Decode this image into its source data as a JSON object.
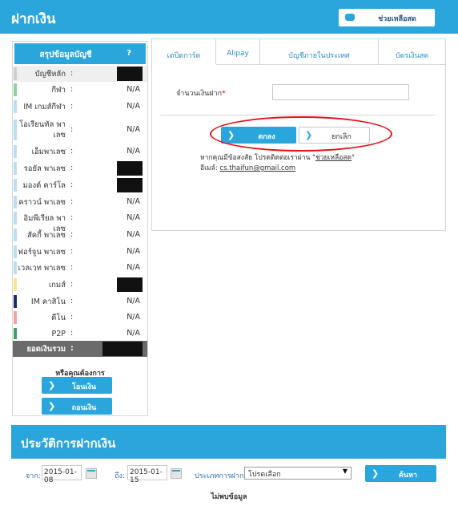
{
  "header": {
    "title": "ฝากเงิน",
    "help_label": "ช่วยเหลือสด"
  },
  "sidebar": {
    "title": "สรุปข้อมูลบัญชี",
    "help_mark": "?",
    "accounts": [
      {
        "name": "บัญชีหลัก",
        "value": "",
        "masked": true,
        "color": "#cfcfcf"
      },
      {
        "name": "กีฬา",
        "value": "N/A",
        "masked": false,
        "color": "#8fd0a0"
      },
      {
        "name": "IM เกมส์กีฬา",
        "value": "N/A",
        "masked": false,
        "color": "#b9dff0"
      },
      {
        "name": "โอเรียนทัล พาเลซ",
        "value": "N/A",
        "masked": false,
        "color": "#b9dff0"
      },
      {
        "name": "เอ็มพาเลซ",
        "value": "N/A",
        "masked": false,
        "color": "#b9dff0"
      },
      {
        "name": "รอยัล พาเลซ",
        "value": "",
        "masked": true,
        "color": "#b9dff0"
      },
      {
        "name": "มองต์ คาร์โล",
        "value": "",
        "masked": true,
        "color": "#b9dff0"
      },
      {
        "name": "คราวน์ พาเลซ",
        "value": "N/A",
        "masked": false,
        "color": "#b9dff0"
      },
      {
        "name": "อิมพีเรียล พาเลซ",
        "value": "N/A",
        "masked": false,
        "color": "#b9dff0"
      },
      {
        "name": "สัคกี้ พาเลซ",
        "value": "N/A",
        "masked": false,
        "color": "#b9dff0"
      },
      {
        "name": "ฟอร์จูน พาเลซ",
        "value": "N/A",
        "masked": false,
        "color": "#b9dff0"
      },
      {
        "name": "เวลเวท พาเลซ",
        "value": "N/A",
        "masked": false,
        "color": "#b9dff0"
      },
      {
        "name": "เกมส์",
        "value": "",
        "masked": true,
        "color": "#f7e58a"
      },
      {
        "name": "IM คาสิโน",
        "value": "N/A",
        "masked": false,
        "color": "#1d2b6b"
      },
      {
        "name": "คีโน",
        "value": "N/A",
        "masked": false,
        "color": "#f0a3a3"
      },
      {
        "name": "P2P",
        "value": "N/A",
        "masked": false,
        "color": "#3d9e6a"
      }
    ],
    "total_label": "ยอดเงินรวม",
    "want_label": "หรือคุณต้องการ",
    "transfer_label": "โอนเงิน",
    "withdraw_label": "ถอนเงิน"
  },
  "tabs": [
    {
      "label": "เดบิตการ์ด",
      "active": true
    },
    {
      "label": "Alipay",
      "active": false
    },
    {
      "label": "บัญชีภายในประเทศ",
      "active": false
    },
    {
      "label": "บัตรเงินสด",
      "active": false
    }
  ],
  "form": {
    "amount_label": "จำนวนเงินฝาก",
    "required_mark": "*",
    "amount_value": "",
    "ok_label": "ตกลง",
    "cancel_label": "ยกเลิก",
    "contact_prefix": "หากคุณมีข้อสงสัย โปรดติดต่อเราผ่าน \"",
    "contact_link": "ช่วยเหลือสด",
    "contact_suffix": "\"",
    "email_label": "อีเมล์:",
    "email": "cs.thaifun@gmail.com"
  },
  "history": {
    "title": "ประวัติการฝากเงิน",
    "from_label": "จาก:",
    "from_date": "2015-01-08",
    "to_label": "ถึง:",
    "to_date": "2015-01-15",
    "type_label": "ประเภทการฝาก:",
    "type_value": "โปรดเลือก",
    "search_label": "ค้นหา",
    "no_data": "ไม่พบข้อมูล"
  },
  "colors": {
    "accent": "#2aa6dd",
    "highlight": "#e0161c"
  }
}
